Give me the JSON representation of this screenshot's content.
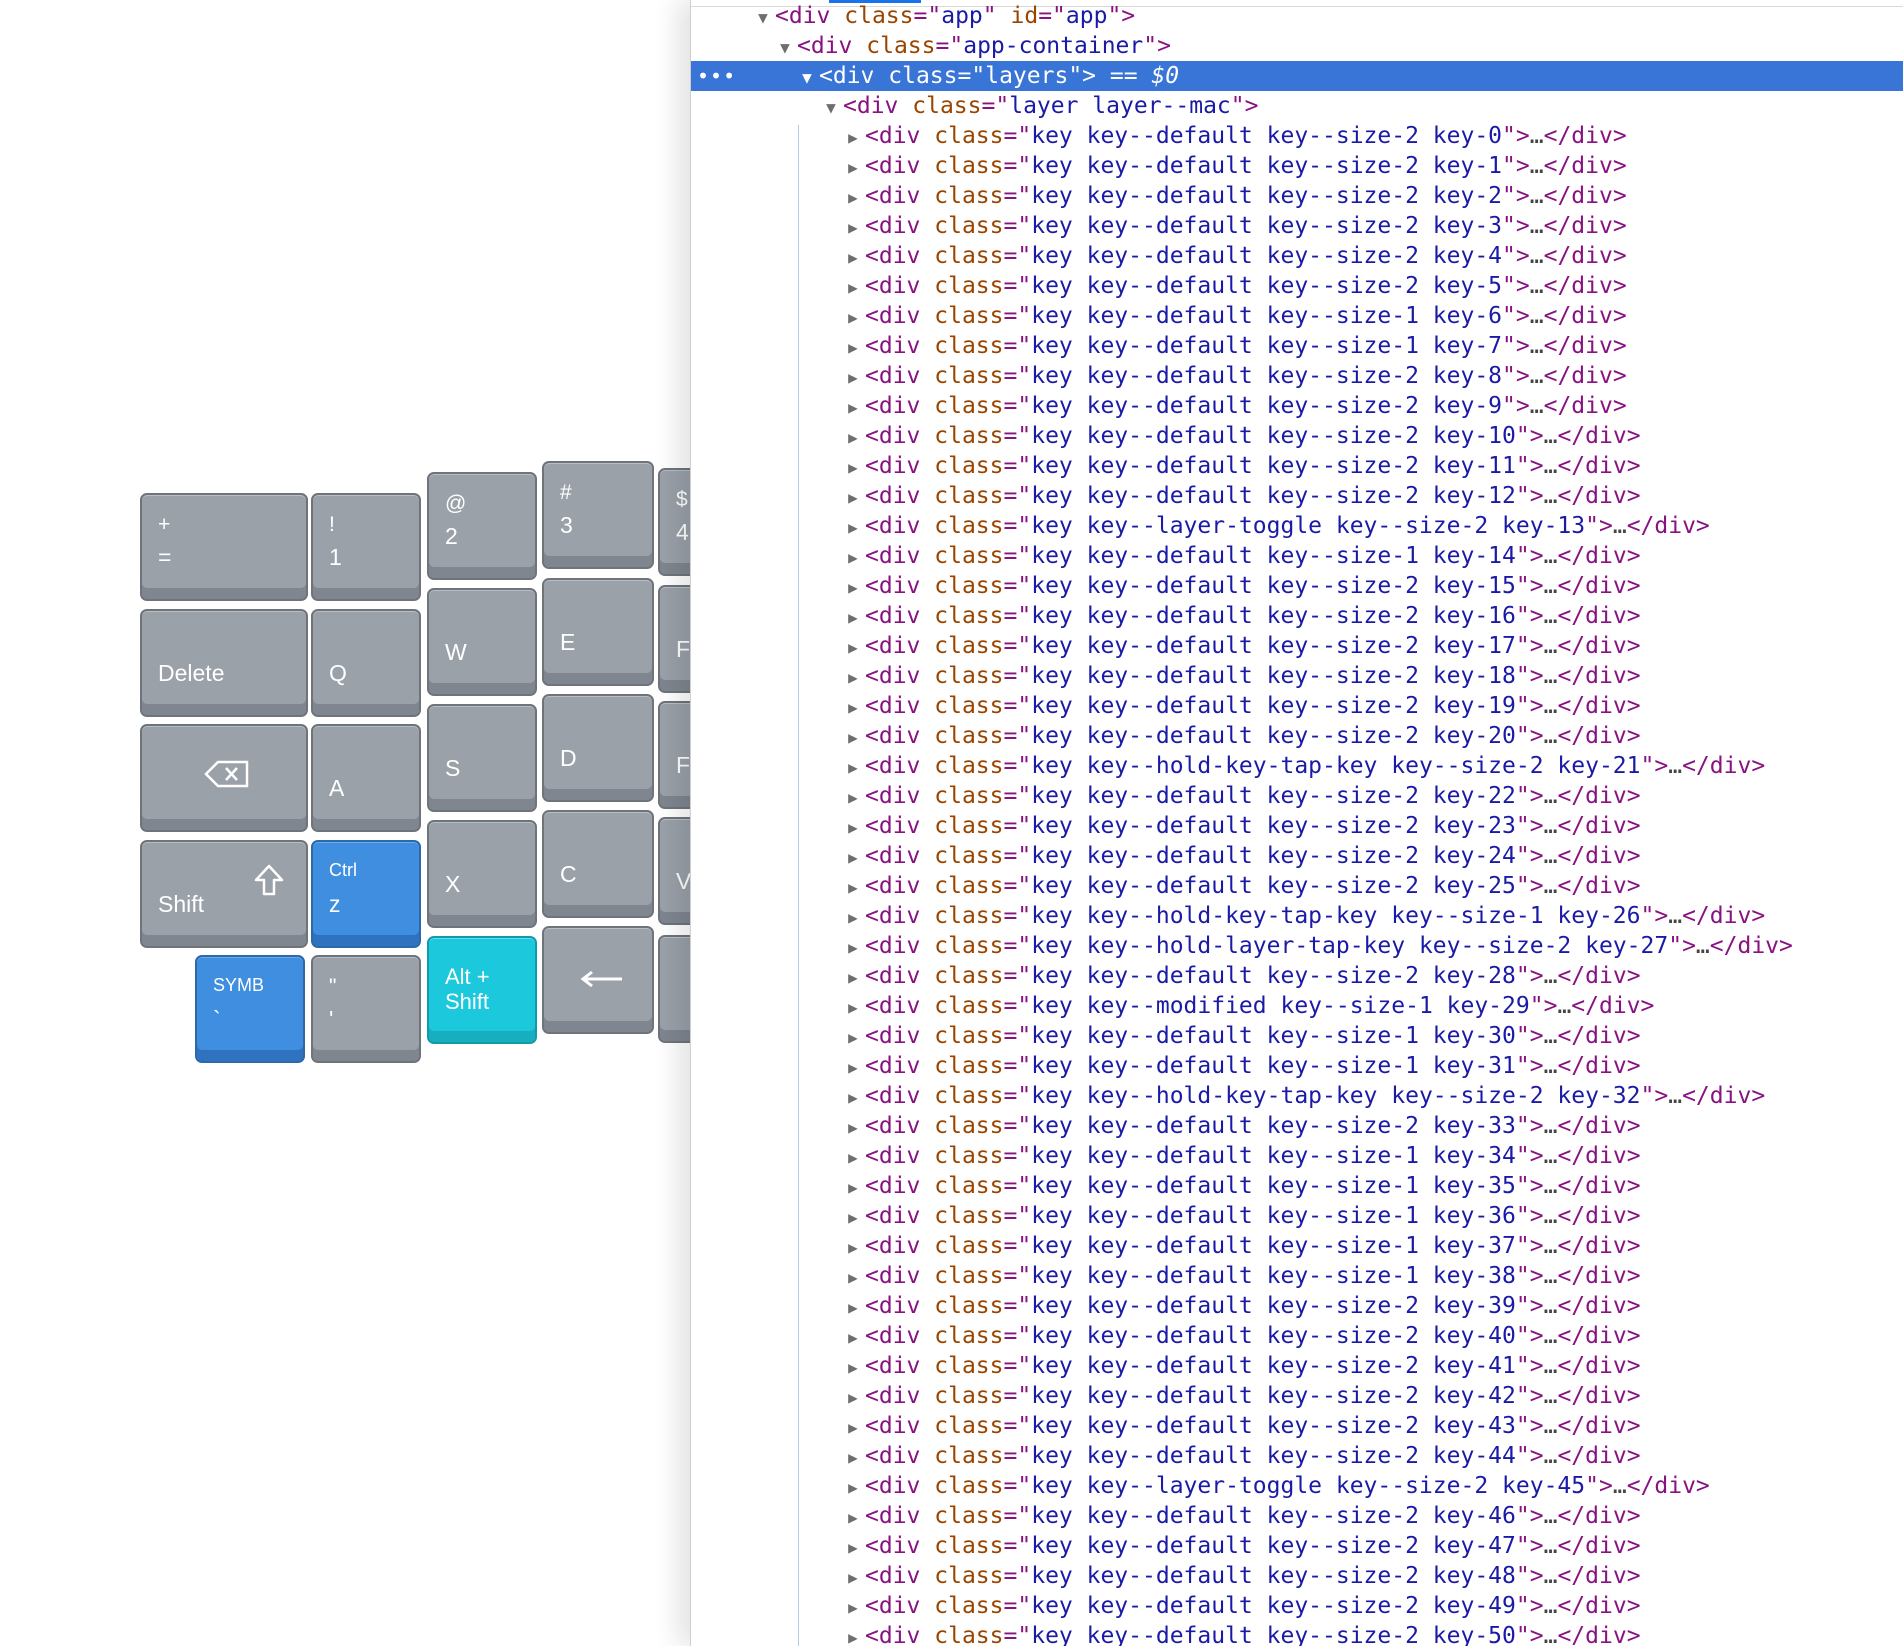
{
  "keyboard": {
    "keys": [
      {
        "name": "key-plus-equals",
        "top": "+",
        "bottom": "=",
        "style": "gray"
      },
      {
        "name": "key-1",
        "top": "!",
        "bottom": "1",
        "style": "gray"
      },
      {
        "name": "key-2",
        "top": "@",
        "bottom": "2",
        "style": "gray"
      },
      {
        "name": "key-3",
        "top": "#",
        "bottom": "3",
        "style": "gray"
      },
      {
        "name": "key-4-partial",
        "top": "$",
        "bottom": "4",
        "style": "gray"
      },
      {
        "name": "key-delete",
        "top": "",
        "bottom": "Delete",
        "style": "gray"
      },
      {
        "name": "key-q",
        "top": "",
        "bottom": "Q",
        "style": "gray"
      },
      {
        "name": "key-w",
        "top": "",
        "bottom": "W",
        "style": "gray"
      },
      {
        "name": "key-e",
        "top": "",
        "bottom": "E",
        "style": "gray"
      },
      {
        "name": "key-r-partial",
        "top": "",
        "bottom": "F",
        "style": "gray"
      },
      {
        "name": "key-backspace",
        "top": "",
        "bottom": "",
        "icon": "backspace-icon",
        "style": "gray"
      },
      {
        "name": "key-a",
        "top": "",
        "bottom": "A",
        "style": "gray"
      },
      {
        "name": "key-s",
        "top": "",
        "bottom": "S",
        "style": "gray"
      },
      {
        "name": "key-d",
        "top": "",
        "bottom": "D",
        "style": "gray"
      },
      {
        "name": "key-f-partial",
        "top": "",
        "bottom": "F",
        "style": "gray"
      },
      {
        "name": "key-shift",
        "top": "",
        "bottom": "Shift",
        "icon": "shift-arrow-icon",
        "style": "gray"
      },
      {
        "name": "key-ctrl-z",
        "top": "Ctrl",
        "bottom": "z",
        "style": "blue"
      },
      {
        "name": "key-x",
        "top": "",
        "bottom": "X",
        "style": "gray"
      },
      {
        "name": "key-c",
        "top": "",
        "bottom": "C",
        "style": "gray"
      },
      {
        "name": "key-v-partial",
        "top": "",
        "bottom": "V",
        "style": "gray"
      },
      {
        "name": "key-symb-backtick",
        "top": "SYMB",
        "bottom": "`",
        "style": "blue"
      },
      {
        "name": "key-quote",
        "top": "\"",
        "bottom": "'",
        "style": "gray"
      },
      {
        "name": "key-alt-shift",
        "top": "",
        "bottom": "",
        "center": "Alt +\nShift",
        "style": "cyan"
      },
      {
        "name": "key-left-arrow",
        "top": "",
        "bottom": "",
        "icon": "left-arrow-icon",
        "style": "gray"
      },
      {
        "name": "key-partial-bottom",
        "top": "",
        "bottom": "",
        "style": "gray"
      }
    ]
  },
  "devtools": {
    "selected_marker": "== $0",
    "dots": "•••",
    "rows": [
      {
        "indent": 0,
        "arrow": "▼",
        "tag": "div",
        "attrs": [
          [
            "class",
            "app"
          ],
          [
            "id",
            "app"
          ]
        ],
        "collapsed": false
      },
      {
        "indent": 1,
        "arrow": "▼",
        "tag": "div",
        "attrs": [
          [
            "class",
            "app-container"
          ]
        ],
        "collapsed": false
      },
      {
        "indent": 2,
        "arrow": "▼",
        "tag": "div",
        "attrs": [
          [
            "class",
            "layers"
          ]
        ],
        "collapsed": false,
        "selected": true
      },
      {
        "indent": 3,
        "arrow": "▼",
        "tag": "div",
        "attrs": [
          [
            "class",
            "layer layer--mac"
          ]
        ],
        "collapsed": false
      },
      {
        "indent": 4,
        "arrow": "▶",
        "tag": "div",
        "attrs": [
          [
            "class",
            "key key--default key--size-2 key-0"
          ]
        ],
        "collapsed": true
      },
      {
        "indent": 4,
        "arrow": "▶",
        "tag": "div",
        "attrs": [
          [
            "class",
            "key key--default key--size-2 key-1"
          ]
        ],
        "collapsed": true
      },
      {
        "indent": 4,
        "arrow": "▶",
        "tag": "div",
        "attrs": [
          [
            "class",
            "key key--default key--size-2 key-2"
          ]
        ],
        "collapsed": true
      },
      {
        "indent": 4,
        "arrow": "▶",
        "tag": "div",
        "attrs": [
          [
            "class",
            "key key--default key--size-2 key-3"
          ]
        ],
        "collapsed": true
      },
      {
        "indent": 4,
        "arrow": "▶",
        "tag": "div",
        "attrs": [
          [
            "class",
            "key key--default key--size-2 key-4"
          ]
        ],
        "collapsed": true
      },
      {
        "indent": 4,
        "arrow": "▶",
        "tag": "div",
        "attrs": [
          [
            "class",
            "key key--default key--size-2 key-5"
          ]
        ],
        "collapsed": true
      },
      {
        "indent": 4,
        "arrow": "▶",
        "tag": "div",
        "attrs": [
          [
            "class",
            "key key--default key--size-1 key-6"
          ]
        ],
        "collapsed": true
      },
      {
        "indent": 4,
        "arrow": "▶",
        "tag": "div",
        "attrs": [
          [
            "class",
            "key key--default key--size-1 key-7"
          ]
        ],
        "collapsed": true
      },
      {
        "indent": 4,
        "arrow": "▶",
        "tag": "div",
        "attrs": [
          [
            "class",
            "key key--default key--size-2 key-8"
          ]
        ],
        "collapsed": true
      },
      {
        "indent": 4,
        "arrow": "▶",
        "tag": "div",
        "attrs": [
          [
            "class",
            "key key--default key--size-2 key-9"
          ]
        ],
        "collapsed": true
      },
      {
        "indent": 4,
        "arrow": "▶",
        "tag": "div",
        "attrs": [
          [
            "class",
            "key key--default key--size-2 key-10"
          ]
        ],
        "collapsed": true
      },
      {
        "indent": 4,
        "arrow": "▶",
        "tag": "div",
        "attrs": [
          [
            "class",
            "key key--default key--size-2 key-11"
          ]
        ],
        "collapsed": true
      },
      {
        "indent": 4,
        "arrow": "▶",
        "tag": "div",
        "attrs": [
          [
            "class",
            "key key--default key--size-2 key-12"
          ]
        ],
        "collapsed": true
      },
      {
        "indent": 4,
        "arrow": "▶",
        "tag": "div",
        "attrs": [
          [
            "class",
            "key key--layer-toggle key--size-2 key-13"
          ]
        ],
        "collapsed": true
      },
      {
        "indent": 4,
        "arrow": "▶",
        "tag": "div",
        "attrs": [
          [
            "class",
            "key key--default key--size-1 key-14"
          ]
        ],
        "collapsed": true
      },
      {
        "indent": 4,
        "arrow": "▶",
        "tag": "div",
        "attrs": [
          [
            "class",
            "key key--default key--size-2 key-15"
          ]
        ],
        "collapsed": true
      },
      {
        "indent": 4,
        "arrow": "▶",
        "tag": "div",
        "attrs": [
          [
            "class",
            "key key--default key--size-2 key-16"
          ]
        ],
        "collapsed": true
      },
      {
        "indent": 4,
        "arrow": "▶",
        "tag": "div",
        "attrs": [
          [
            "class",
            "key key--default key--size-2 key-17"
          ]
        ],
        "collapsed": true
      },
      {
        "indent": 4,
        "arrow": "▶",
        "tag": "div",
        "attrs": [
          [
            "class",
            "key key--default key--size-2 key-18"
          ]
        ],
        "collapsed": true
      },
      {
        "indent": 4,
        "arrow": "▶",
        "tag": "div",
        "attrs": [
          [
            "class",
            "key key--default key--size-2 key-19"
          ]
        ],
        "collapsed": true
      },
      {
        "indent": 4,
        "arrow": "▶",
        "tag": "div",
        "attrs": [
          [
            "class",
            "key key--default key--size-2 key-20"
          ]
        ],
        "collapsed": true
      },
      {
        "indent": 4,
        "arrow": "▶",
        "tag": "div",
        "attrs": [
          [
            "class",
            "key key--hold-key-tap-key key--size-2 key-21"
          ]
        ],
        "collapsed": true
      },
      {
        "indent": 4,
        "arrow": "▶",
        "tag": "div",
        "attrs": [
          [
            "class",
            "key key--default key--size-2 key-22"
          ]
        ],
        "collapsed": true
      },
      {
        "indent": 4,
        "arrow": "▶",
        "tag": "div",
        "attrs": [
          [
            "class",
            "key key--default key--size-2 key-23"
          ]
        ],
        "collapsed": true
      },
      {
        "indent": 4,
        "arrow": "▶",
        "tag": "div",
        "attrs": [
          [
            "class",
            "key key--default key--size-2 key-24"
          ]
        ],
        "collapsed": true
      },
      {
        "indent": 4,
        "arrow": "▶",
        "tag": "div",
        "attrs": [
          [
            "class",
            "key key--default key--size-2 key-25"
          ]
        ],
        "collapsed": true
      },
      {
        "indent": 4,
        "arrow": "▶",
        "tag": "div",
        "attrs": [
          [
            "class",
            "key key--hold-key-tap-key key--size-1 key-26"
          ]
        ],
        "collapsed": true
      },
      {
        "indent": 4,
        "arrow": "▶",
        "tag": "div",
        "attrs": [
          [
            "class",
            "key key--hold-layer-tap-key key--size-2 key-27"
          ]
        ],
        "collapsed": true
      },
      {
        "indent": 4,
        "arrow": "▶",
        "tag": "div",
        "attrs": [
          [
            "class",
            "key key--default key--size-2 key-28"
          ]
        ],
        "collapsed": true
      },
      {
        "indent": 4,
        "arrow": "▶",
        "tag": "div",
        "attrs": [
          [
            "class",
            "key key--modified key--size-1 key-29"
          ]
        ],
        "collapsed": true
      },
      {
        "indent": 4,
        "arrow": "▶",
        "tag": "div",
        "attrs": [
          [
            "class",
            "key key--default key--size-1 key-30"
          ]
        ],
        "collapsed": true
      },
      {
        "indent": 4,
        "arrow": "▶",
        "tag": "div",
        "attrs": [
          [
            "class",
            "key key--default key--size-1 key-31"
          ]
        ],
        "collapsed": true
      },
      {
        "indent": 4,
        "arrow": "▶",
        "tag": "div",
        "attrs": [
          [
            "class",
            "key key--hold-key-tap-key key--size-2 key-32"
          ]
        ],
        "collapsed": true
      },
      {
        "indent": 4,
        "arrow": "▶",
        "tag": "div",
        "attrs": [
          [
            "class",
            "key key--default key--size-2 key-33"
          ]
        ],
        "collapsed": true
      },
      {
        "indent": 4,
        "arrow": "▶",
        "tag": "div",
        "attrs": [
          [
            "class",
            "key key--default key--size-1 key-34"
          ]
        ],
        "collapsed": true
      },
      {
        "indent": 4,
        "arrow": "▶",
        "tag": "div",
        "attrs": [
          [
            "class",
            "key key--default key--size-1 key-35"
          ]
        ],
        "collapsed": true
      },
      {
        "indent": 4,
        "arrow": "▶",
        "tag": "div",
        "attrs": [
          [
            "class",
            "key key--default key--size-1 key-36"
          ]
        ],
        "collapsed": true
      },
      {
        "indent": 4,
        "arrow": "▶",
        "tag": "div",
        "attrs": [
          [
            "class",
            "key key--default key--size-1 key-37"
          ]
        ],
        "collapsed": true
      },
      {
        "indent": 4,
        "arrow": "▶",
        "tag": "div",
        "attrs": [
          [
            "class",
            "key key--default key--size-1 key-38"
          ]
        ],
        "collapsed": true
      },
      {
        "indent": 4,
        "arrow": "▶",
        "tag": "div",
        "attrs": [
          [
            "class",
            "key key--default key--size-2 key-39"
          ]
        ],
        "collapsed": true
      },
      {
        "indent": 4,
        "arrow": "▶",
        "tag": "div",
        "attrs": [
          [
            "class",
            "key key--default key--size-2 key-40"
          ]
        ],
        "collapsed": true
      },
      {
        "indent": 4,
        "arrow": "▶",
        "tag": "div",
        "attrs": [
          [
            "class",
            "key key--default key--size-2 key-41"
          ]
        ],
        "collapsed": true
      },
      {
        "indent": 4,
        "arrow": "▶",
        "tag": "div",
        "attrs": [
          [
            "class",
            "key key--default key--size-2 key-42"
          ]
        ],
        "collapsed": true
      },
      {
        "indent": 4,
        "arrow": "▶",
        "tag": "div",
        "attrs": [
          [
            "class",
            "key key--default key--size-2 key-43"
          ]
        ],
        "collapsed": true
      },
      {
        "indent": 4,
        "arrow": "▶",
        "tag": "div",
        "attrs": [
          [
            "class",
            "key key--default key--size-2 key-44"
          ]
        ],
        "collapsed": true
      },
      {
        "indent": 4,
        "arrow": "▶",
        "tag": "div",
        "attrs": [
          [
            "class",
            "key key--layer-toggle key--size-2 key-45"
          ]
        ],
        "collapsed": true
      },
      {
        "indent": 4,
        "arrow": "▶",
        "tag": "div",
        "attrs": [
          [
            "class",
            "key key--default key--size-2 key-46"
          ]
        ],
        "collapsed": true
      },
      {
        "indent": 4,
        "arrow": "▶",
        "tag": "div",
        "attrs": [
          [
            "class",
            "key key--default key--size-2 key-47"
          ]
        ],
        "collapsed": true
      },
      {
        "indent": 4,
        "arrow": "▶",
        "tag": "div",
        "attrs": [
          [
            "class",
            "key key--default key--size-2 key-48"
          ]
        ],
        "collapsed": true
      },
      {
        "indent": 4,
        "arrow": "▶",
        "tag": "div",
        "attrs": [
          [
            "class",
            "key key--default key--size-2 key-49"
          ]
        ],
        "collapsed": true
      },
      {
        "indent": 4,
        "arrow": "▶",
        "tag": "div",
        "attrs": [
          [
            "class",
            "key key--default key--size-2 key-50"
          ]
        ],
        "collapsed": true
      }
    ]
  },
  "colors": {
    "key_gray": "#9aa1a9",
    "key_blue": "#3f8ee0",
    "key_cyan": "#1cc8dc",
    "selection": "#3875d7",
    "tag": "#881280",
    "attr_name": "#994500",
    "attr_value": "#1a1aa6"
  }
}
